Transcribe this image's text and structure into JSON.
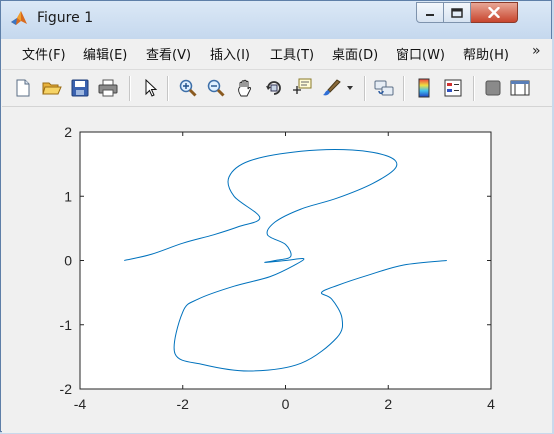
{
  "window": {
    "title": "Figure 1",
    "icon": "matlab-icon",
    "controls": [
      "minimize-icon",
      "maximize-icon",
      "close-icon"
    ]
  },
  "menu": {
    "items": [
      "文件(F)",
      "编辑(E)",
      "查看(V)",
      "插入(I)",
      "工具(T)",
      "桌面(D)",
      "窗口(W)",
      "帮助(H)"
    ],
    "overflow_glyph": "»"
  },
  "toolbar": {
    "icons": [
      "new-figure-icon",
      "open-file-icon",
      "save-icon",
      "print-icon",
      "edit-plot-arrow-icon",
      "zoom-in-icon",
      "zoom-out-icon",
      "pan-icon",
      "rotate-3d-icon",
      "data-cursor-icon",
      "brush-icon",
      "link-plot-icon",
      "colorbar-icon",
      "legend-icon",
      "hide-plot-tools-icon",
      "show-plot-tools-icon"
    ]
  },
  "colors": {
    "line": "#0072bd",
    "axes_bg": "#ffffff",
    "figure_bg": "#f0f0f0",
    "axis_color": "#262626"
  },
  "chart_data": {
    "type": "line",
    "title": "",
    "xlabel": "",
    "ylabel": "",
    "xlim": [
      -4,
      4
    ],
    "ylim": [
      -2,
      2
    ],
    "x_ticks": [
      -4,
      -2,
      0,
      2,
      4
    ],
    "y_ticks": [
      -2,
      -1,
      0,
      1,
      2
    ],
    "x_tick_labels": [
      "-4",
      "-2",
      "0",
      "2",
      "4"
    ],
    "y_tick_labels": [
      "-2",
      "-1",
      "0",
      "1",
      "2"
    ],
    "grid": false,
    "series": [
      {
        "x": [
          -3.14,
          -2.6,
          -2.0,
          -1.4,
          -0.9,
          -0.5,
          -1.0,
          -1.1,
          -0.7,
          0.3,
          1.3,
          2.0,
          2.15,
          1.7,
          1.0,
          0.3,
          -0.2,
          -0.35,
          0.0,
          0.1,
          -0.2,
          -0.4,
          0.0,
          0.35,
          0.2,
          -0.3,
          -1.0,
          -1.7,
          -2.0,
          -2.15,
          -1.6,
          -0.7,
          0.3,
          1.0,
          1.1,
          0.9,
          0.7,
          1.0,
          1.6,
          2.3,
          3.14
        ],
        "y": [
          0.0,
          0.1,
          0.27,
          0.4,
          0.53,
          0.67,
          1.0,
          1.3,
          1.55,
          1.7,
          1.72,
          1.62,
          1.45,
          1.2,
          0.97,
          0.8,
          0.6,
          0.4,
          0.25,
          0.06,
          0.0,
          -0.03,
          0.0,
          0.03,
          -0.06,
          -0.25,
          -0.4,
          -0.6,
          -0.8,
          -1.45,
          -1.62,
          -1.72,
          -1.6,
          -1.2,
          -0.9,
          -0.6,
          -0.5,
          -0.39,
          -0.23,
          -0.07,
          0.0
        ]
      }
    ]
  }
}
